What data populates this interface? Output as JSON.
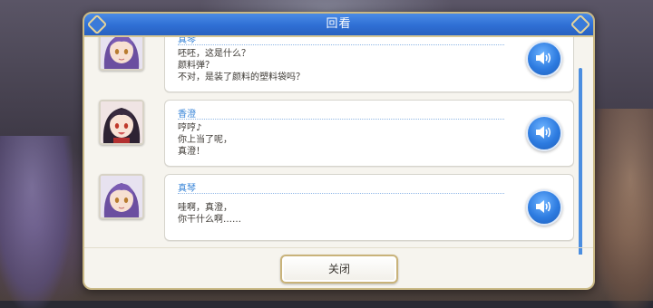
{
  "dialog": {
    "title": "回看",
    "close_label": "关闭"
  },
  "entries": [
    {
      "speaker": "真琴",
      "lines": [
        "呸呸，这是什么？",
        "颜料弹？",
        "不对，是装了颜料的塑料袋吗？"
      ],
      "avatar_icon": "makoto-avatar"
    },
    {
      "speaker": "香澄",
      "lines": [
        "哼哼♪",
        "你上当了呢，",
        "真澄！"
      ],
      "avatar_icon": "kasumi-avatar"
    },
    {
      "speaker": "真琴",
      "lines": [
        "哇啊，真澄，",
        "你干什么啊……"
      ],
      "avatar_icon": "makoto-avatar"
    }
  ],
  "icons": {
    "voice": "speaker-icon"
  },
  "colors": {
    "title_bar": "#2f6fd4",
    "speaker_name": "#3a86d8",
    "voice_button": "#2d7be0",
    "frame_gold": "#c9b884"
  }
}
